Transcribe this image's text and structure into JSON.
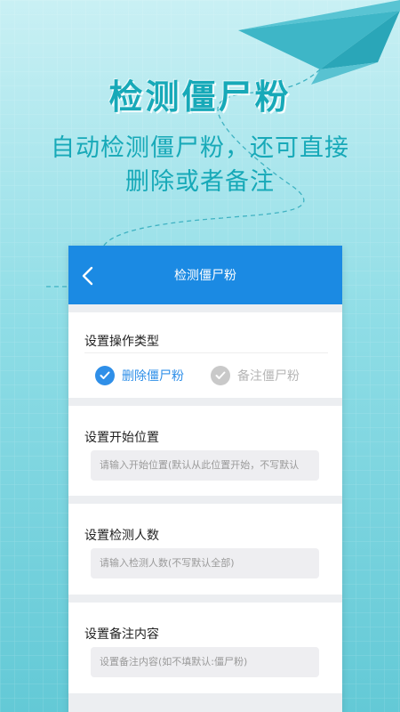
{
  "promo": {
    "headline": "检测僵尸粉",
    "sub_line1": "自动检测僵尸粉，还可直接",
    "sub_line2": "删除或者备注"
  },
  "app": {
    "title": "检测僵尸粉",
    "back_icon": "chevron-left-icon"
  },
  "operation": {
    "label": "设置操作类型",
    "options": [
      {
        "label": "删除僵尸粉",
        "selected": true
      },
      {
        "label": "备注僵尸粉",
        "selected": false
      }
    ]
  },
  "start_position": {
    "label": "设置开始位置",
    "placeholder": "请输入开始位置(默认从此位置开始，不写默认"
  },
  "detect_count": {
    "label": "设置检测人数",
    "placeholder": "请输入检测人数(不写默认全部)"
  },
  "remark": {
    "label": "设置备注内容",
    "placeholder": "设置备注内容(如不填默认:僵尸粉)"
  },
  "colors": {
    "accent": "#1b8ae3",
    "promo_text": "#17a9b8",
    "background": "#8fdde6"
  }
}
